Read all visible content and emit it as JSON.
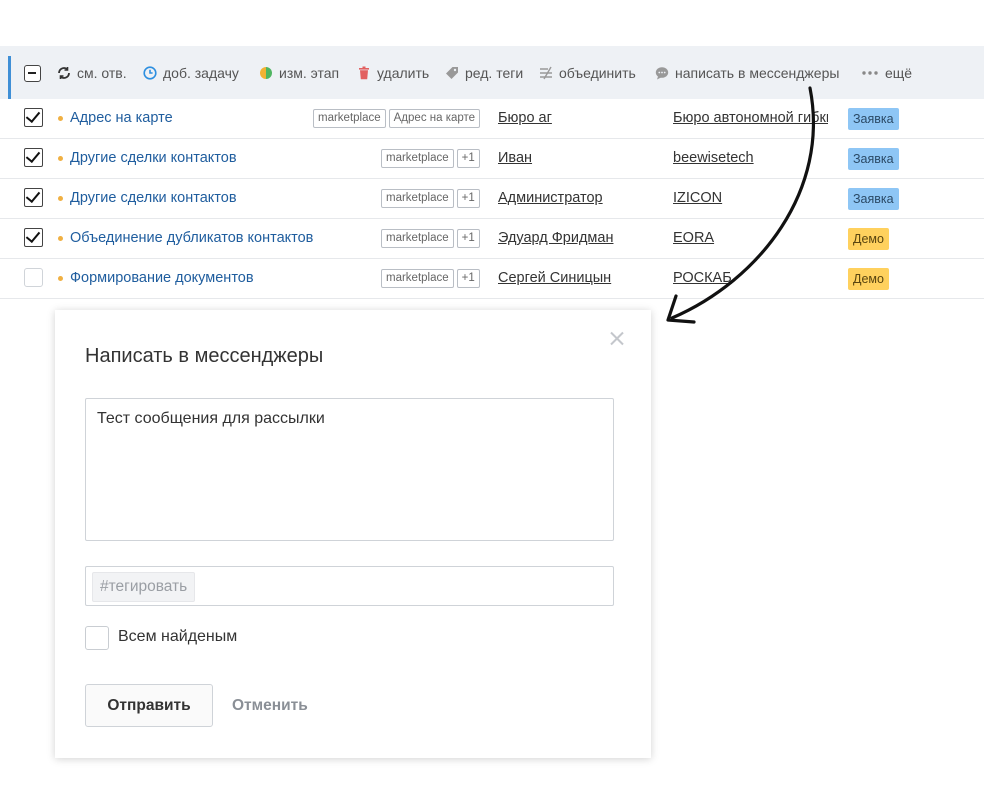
{
  "toolbar": {
    "items": [
      {
        "label": "см. отв.",
        "icon": "refresh-icon"
      },
      {
        "label": "доб. задачу",
        "icon": "clock-icon"
      },
      {
        "label": "изм. этап",
        "icon": "half-circle-icon"
      },
      {
        "label": "удалить",
        "icon": "trash-icon"
      },
      {
        "label": "ред. теги",
        "icon": "tag-icon"
      },
      {
        "label": "объединить",
        "icon": "merge-icon"
      },
      {
        "label": "написать в мессенджеры",
        "icon": "chat-bubble-icon"
      },
      {
        "label": "ещё",
        "icon": "more-dots-icon"
      }
    ]
  },
  "rows": [
    {
      "checked": true,
      "title": "Адрес на карте",
      "tags": [
        "marketplace",
        "Адрес на карте"
      ],
      "contact": "Бюро аг",
      "company": "Бюро автономной гибки",
      "stage": "Заявка",
      "stage_color": "#8ec6f5"
    },
    {
      "checked": true,
      "title": "Другие сделки контактов",
      "tags": [
        "marketplace",
        "+1"
      ],
      "contact": "Иван",
      "company": "beewisetech",
      "stage": "Заявка",
      "stage_color": "#8ec6f5"
    },
    {
      "checked": true,
      "title": "Другие сделки контактов",
      "tags": [
        "marketplace",
        "+1"
      ],
      "contact": "Администратор",
      "company": "IZICON",
      "stage": "Заявка",
      "stage_color": "#8ec6f5"
    },
    {
      "checked": true,
      "title": "Объединение дубликатов контактов",
      "tags": [
        "marketplace",
        "+1"
      ],
      "contact": "Эдуард Фридман",
      "company": "EORA",
      "stage": "Демо",
      "stage_color": "#ffd15e"
    },
    {
      "checked": false,
      "title": "Формирование документов",
      "tags": [
        "marketplace",
        "+1"
      ],
      "contact": "Сергей Синицын",
      "company": "РОСКАБ",
      "stage": "Демо",
      "stage_color": "#ffd15e"
    }
  ],
  "modal": {
    "title": "Написать в мессенджеры",
    "message": "Тест сообщения для рассылки",
    "tag_placeholder": "#тегировать",
    "all_found_label": "Всем найденым",
    "send_label": "Отправить",
    "cancel_label": "Отменить"
  },
  "colors": {
    "accent": "#3f8fd6",
    "link": "#1f5d9e",
    "stage_blue": "#8ec6f5",
    "stage_yellow": "#ffd15e"
  }
}
